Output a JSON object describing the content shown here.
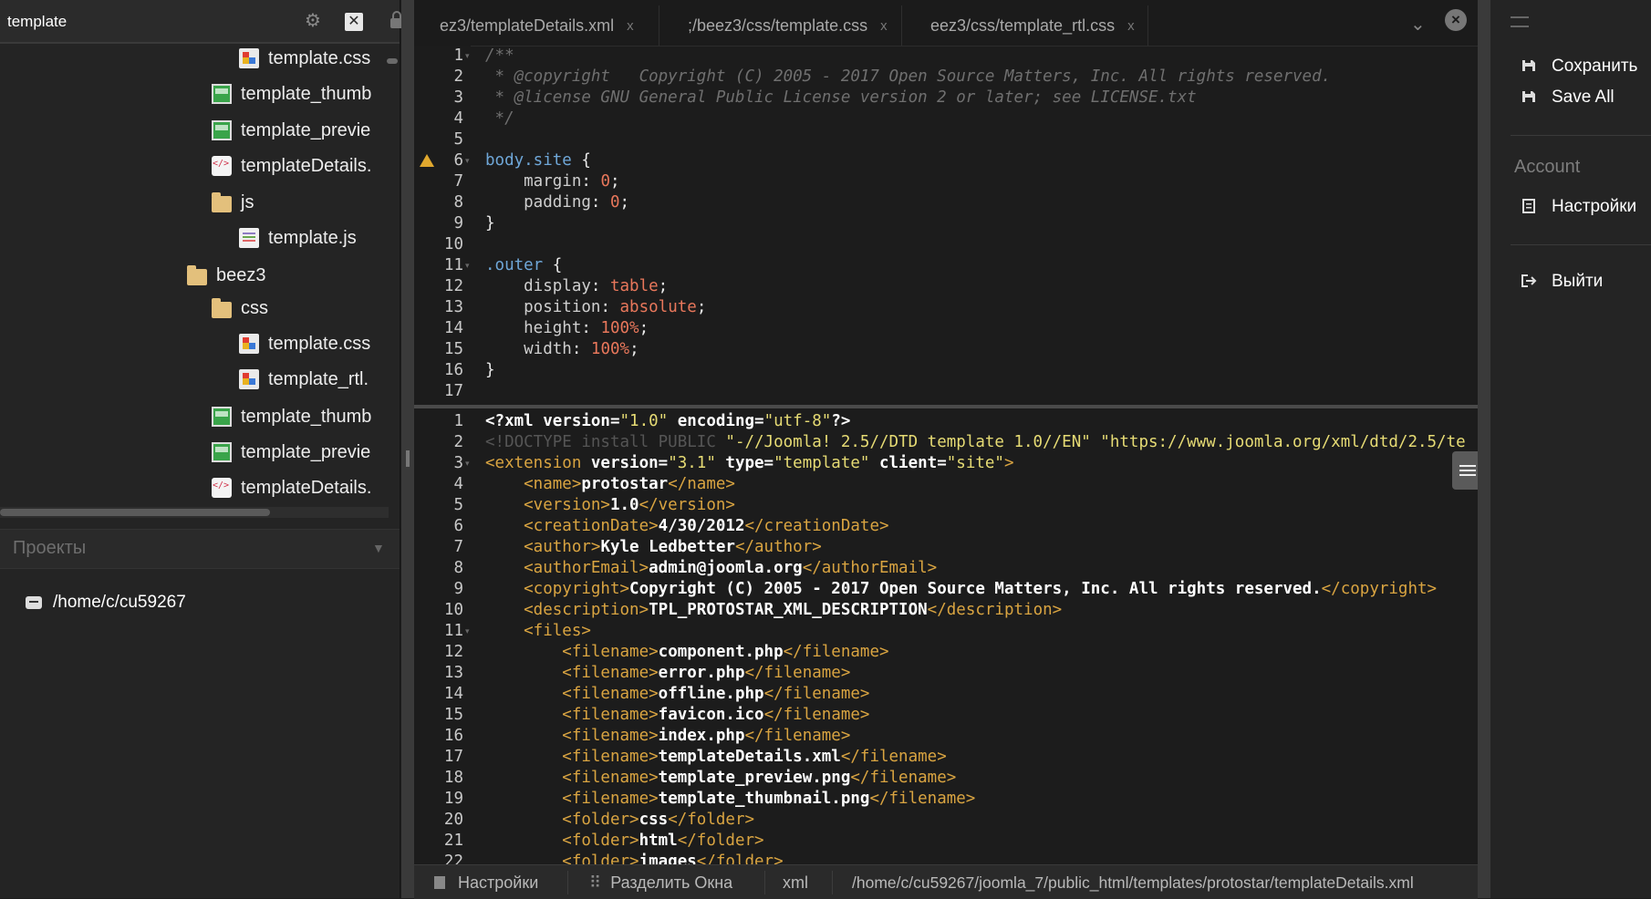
{
  "sidebar": {
    "filter_value": "template",
    "tree": [
      {
        "label": "template.css",
        "type": "css"
      },
      {
        "label": "template_thumb",
        "type": "image"
      },
      {
        "label": "template_previe",
        "type": "image"
      },
      {
        "label": "templateDetails.",
        "type": "xml"
      },
      {
        "label": "js",
        "type": "folder"
      },
      {
        "label": "template.js",
        "type": "js"
      },
      {
        "label": "beez3",
        "type": "folder"
      },
      {
        "label": "css",
        "type": "folder"
      },
      {
        "label": "template.css",
        "type": "css"
      },
      {
        "label": "template_rtl.",
        "type": "css"
      },
      {
        "label": "template_thumb",
        "type": "image"
      },
      {
        "label": "template_previe",
        "type": "image"
      },
      {
        "label": "templateDetails.",
        "type": "xml"
      }
    ],
    "projects_title": "Проекты",
    "project_path": "/home/c/cu59267"
  },
  "tabs": [
    {
      "label": "ez3/templateDetails.xml",
      "close": "x"
    },
    {
      "label": ";/beez3/css/template.css",
      "close": "x"
    },
    {
      "label": "eez3/css/template_rtl.css",
      "close": "x"
    }
  ],
  "pane1": {
    "line_numbers": [
      "1",
      "2",
      "3",
      "4",
      "5",
      "6",
      "7",
      "8",
      "9",
      "10",
      "11",
      "12",
      "13",
      "14",
      "15",
      "16",
      "17"
    ],
    "lines": [
      [
        [
          "c-comment",
          "/**"
        ]
      ],
      [
        [
          "c-comment",
          " * @copyright   Copyright (C) 2005 - 2017 Open Source Matters, Inc. All rights reserved."
        ]
      ],
      [
        [
          "c-comment",
          " * @license GNU General Public License version 2 or later; see LICENSE.txt"
        ]
      ],
      [
        [
          "c-comment",
          " */"
        ]
      ],
      [],
      [
        [
          "c-sel",
          "body.site"
        ],
        [
          "c-punc",
          " {"
        ]
      ],
      [
        [
          "c-prop",
          "    margin"
        ],
        [
          "c-punc",
          ": "
        ],
        [
          "c-val",
          "0"
        ],
        [
          "c-punc",
          ";"
        ]
      ],
      [
        [
          "c-prop",
          "    padding"
        ],
        [
          "c-punc",
          ": "
        ],
        [
          "c-val",
          "0"
        ],
        [
          "c-punc",
          ";"
        ]
      ],
      [
        [
          "c-punc",
          "}"
        ]
      ],
      [],
      [
        [
          "c-sel",
          ".outer"
        ],
        [
          "c-punc",
          " {"
        ]
      ],
      [
        [
          "c-prop",
          "    display"
        ],
        [
          "c-punc",
          ": "
        ],
        [
          "c-val",
          "table"
        ],
        [
          "c-punc",
          ";"
        ]
      ],
      [
        [
          "c-prop",
          "    position"
        ],
        [
          "c-punc",
          ": "
        ],
        [
          "c-val",
          "absolute"
        ],
        [
          "c-punc",
          ";"
        ]
      ],
      [
        [
          "c-prop",
          "    height"
        ],
        [
          "c-punc",
          ": "
        ],
        [
          "c-val",
          "100%"
        ],
        [
          "c-punc",
          ";"
        ]
      ],
      [
        [
          "c-prop",
          "    width"
        ],
        [
          "c-punc",
          ": "
        ],
        [
          "c-val",
          "100%"
        ],
        [
          "c-punc",
          ";"
        ]
      ],
      [
        [
          "c-punc",
          "}"
        ]
      ],
      []
    ]
  },
  "pane2": {
    "line_numbers": [
      "1",
      "2",
      "3",
      "4",
      "5",
      "6",
      "7",
      "8",
      "9",
      "10",
      "11",
      "12",
      "13",
      "14",
      "15",
      "16",
      "17",
      "18",
      "19",
      "20",
      "21",
      "22"
    ],
    "lines": [
      [
        [
          "c-text",
          "<?xml version="
        ],
        [
          "c-str",
          "\"1.0\""
        ],
        [
          "c-text",
          " encoding="
        ],
        [
          "c-str",
          "\"utf-8\""
        ],
        [
          "c-text",
          "?>"
        ]
      ],
      [
        [
          "c-doctype",
          "<!DOCTYPE install PUBLIC "
        ],
        [
          "c-str",
          "\"-//Joomla! 2.5//DTD template 1.0//EN\" \"https://www.joomla.org/xml/dtd/2.5/te"
        ]
      ],
      [
        [
          "c-tag",
          "<extension"
        ],
        [
          "c-attr",
          " version="
        ],
        [
          "c-str",
          "\"3.1\""
        ],
        [
          "c-attr",
          " type="
        ],
        [
          "c-str",
          "\"template\""
        ],
        [
          "c-attr",
          " client="
        ],
        [
          "c-str",
          "\"site\""
        ],
        [
          "c-tag",
          ">"
        ]
      ],
      [
        [
          "c-tag",
          "    <name>"
        ],
        [
          "c-text",
          "protostar"
        ],
        [
          "c-tag",
          "</name>"
        ]
      ],
      [
        [
          "c-tag",
          "    <version>"
        ],
        [
          "c-text",
          "1.0"
        ],
        [
          "c-tag",
          "</version>"
        ]
      ],
      [
        [
          "c-tag",
          "    <creationDate>"
        ],
        [
          "c-text",
          "4/30/2012"
        ],
        [
          "c-tag",
          "</creationDate>"
        ]
      ],
      [
        [
          "c-tag",
          "    <author>"
        ],
        [
          "c-text",
          "Kyle Ledbetter"
        ],
        [
          "c-tag",
          "</author>"
        ]
      ],
      [
        [
          "c-tag",
          "    <authorEmail>"
        ],
        [
          "c-text",
          "admin@joomla.org"
        ],
        [
          "c-tag",
          "</authorEmail>"
        ]
      ],
      [
        [
          "c-tag",
          "    <copyright>"
        ],
        [
          "c-text",
          "Copyright (C) 2005 - 2017 Open Source Matters, Inc. All rights reserved."
        ],
        [
          "c-tag",
          "</copyright>"
        ]
      ],
      [
        [
          "c-tag",
          "    <description>"
        ],
        [
          "c-text",
          "TPL_PROTOSTAR_XML_DESCRIPTION"
        ],
        [
          "c-tag",
          "</description>"
        ]
      ],
      [
        [
          "c-tag",
          "    <files>"
        ]
      ],
      [
        [
          "c-tag",
          "        <filename>"
        ],
        [
          "c-text",
          "component.php"
        ],
        [
          "c-tag",
          "</filename>"
        ]
      ],
      [
        [
          "c-tag",
          "        <filename>"
        ],
        [
          "c-text",
          "error.php"
        ],
        [
          "c-tag",
          "</filename>"
        ]
      ],
      [
        [
          "c-tag",
          "        <filename>"
        ],
        [
          "c-text",
          "offline.php"
        ],
        [
          "c-tag",
          "</filename>"
        ]
      ],
      [
        [
          "c-tag",
          "        <filename>"
        ],
        [
          "c-text",
          "favicon.ico"
        ],
        [
          "c-tag",
          "</filename>"
        ]
      ],
      [
        [
          "c-tag",
          "        <filename>"
        ],
        [
          "c-text",
          "index.php"
        ],
        [
          "c-tag",
          "</filename>"
        ]
      ],
      [
        [
          "c-tag",
          "        <filename>"
        ],
        [
          "c-text",
          "templateDetails.xml"
        ],
        [
          "c-tag",
          "</filename>"
        ]
      ],
      [
        [
          "c-tag",
          "        <filename>"
        ],
        [
          "c-text",
          "template_preview.png"
        ],
        [
          "c-tag",
          "</filename>"
        ]
      ],
      [
        [
          "c-tag",
          "        <filename>"
        ],
        [
          "c-text",
          "template_thumbnail.png"
        ],
        [
          "c-tag",
          "</filename>"
        ]
      ],
      [
        [
          "c-tag",
          "        <folder>"
        ],
        [
          "c-text",
          "css"
        ],
        [
          "c-tag",
          "</folder>"
        ]
      ],
      [
        [
          "c-tag",
          "        <folder>"
        ],
        [
          "c-text",
          "html"
        ],
        [
          "c-tag",
          "</folder>"
        ]
      ],
      [
        [
          "c-tag",
          "        <folder>"
        ],
        [
          "c-text",
          "images"
        ],
        [
          "c-tag",
          "</folder>"
        ]
      ]
    ]
  },
  "statusbar": {
    "settings": "Настройки",
    "split": "Разделить Окна",
    "mode": "xml",
    "path": "/home/c/cu59267/joomla_7/public_html/templates/protostar/templateDetails.xml"
  },
  "right_panel": {
    "save": "Сохранить",
    "save_all": "Save All",
    "account_heading": "Account",
    "settings": "Настройки",
    "logout": "Выйти"
  },
  "icons": {
    "save": "floppy-icon",
    "settings": "document-icon",
    "logout": "exit-icon"
  }
}
